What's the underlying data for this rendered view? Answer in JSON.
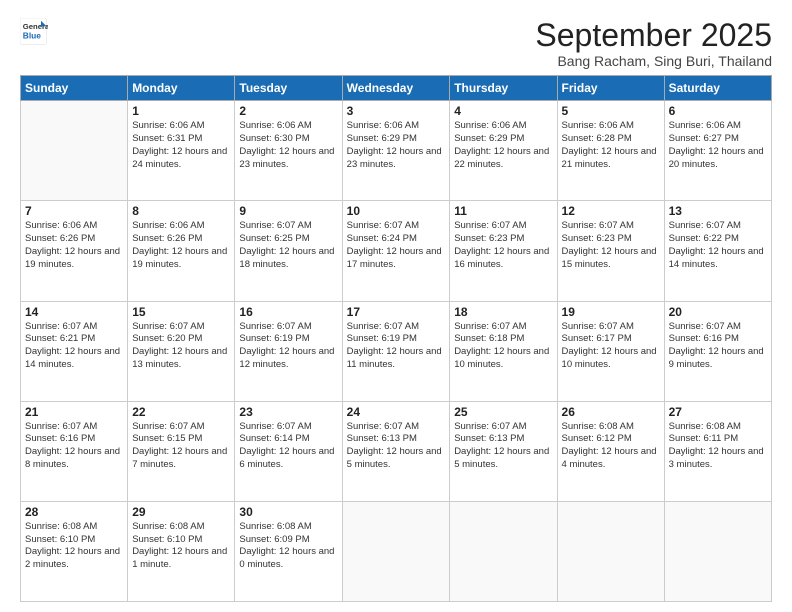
{
  "logo": {
    "line1": "General",
    "line2": "Blue"
  },
  "title": "September 2025",
  "subtitle": "Bang Racham, Sing Buri, Thailand",
  "days_of_week": [
    "Sunday",
    "Monday",
    "Tuesday",
    "Wednesday",
    "Thursday",
    "Friday",
    "Saturday"
  ],
  "weeks": [
    [
      {
        "day": null
      },
      {
        "day": 1,
        "sunrise": "6:06 AM",
        "sunset": "6:31 PM",
        "daylight": "12 hours and 24 minutes."
      },
      {
        "day": 2,
        "sunrise": "6:06 AM",
        "sunset": "6:30 PM",
        "daylight": "12 hours and 23 minutes."
      },
      {
        "day": 3,
        "sunrise": "6:06 AM",
        "sunset": "6:29 PM",
        "daylight": "12 hours and 23 minutes."
      },
      {
        "day": 4,
        "sunrise": "6:06 AM",
        "sunset": "6:29 PM",
        "daylight": "12 hours and 22 minutes."
      },
      {
        "day": 5,
        "sunrise": "6:06 AM",
        "sunset": "6:28 PM",
        "daylight": "12 hours and 21 minutes."
      },
      {
        "day": 6,
        "sunrise": "6:06 AM",
        "sunset": "6:27 PM",
        "daylight": "12 hours and 20 minutes."
      }
    ],
    [
      {
        "day": 7,
        "sunrise": "6:06 AM",
        "sunset": "6:26 PM",
        "daylight": "12 hours and 19 minutes."
      },
      {
        "day": 8,
        "sunrise": "6:06 AM",
        "sunset": "6:26 PM",
        "daylight": "12 hours and 19 minutes."
      },
      {
        "day": 9,
        "sunrise": "6:07 AM",
        "sunset": "6:25 PM",
        "daylight": "12 hours and 18 minutes."
      },
      {
        "day": 10,
        "sunrise": "6:07 AM",
        "sunset": "6:24 PM",
        "daylight": "12 hours and 17 minutes."
      },
      {
        "day": 11,
        "sunrise": "6:07 AM",
        "sunset": "6:23 PM",
        "daylight": "12 hours and 16 minutes."
      },
      {
        "day": 12,
        "sunrise": "6:07 AM",
        "sunset": "6:23 PM",
        "daylight": "12 hours and 15 minutes."
      },
      {
        "day": 13,
        "sunrise": "6:07 AM",
        "sunset": "6:22 PM",
        "daylight": "12 hours and 14 minutes."
      }
    ],
    [
      {
        "day": 14,
        "sunrise": "6:07 AM",
        "sunset": "6:21 PM",
        "daylight": "12 hours and 14 minutes."
      },
      {
        "day": 15,
        "sunrise": "6:07 AM",
        "sunset": "6:20 PM",
        "daylight": "12 hours and 13 minutes."
      },
      {
        "day": 16,
        "sunrise": "6:07 AM",
        "sunset": "6:19 PM",
        "daylight": "12 hours and 12 minutes."
      },
      {
        "day": 17,
        "sunrise": "6:07 AM",
        "sunset": "6:19 PM",
        "daylight": "12 hours and 11 minutes."
      },
      {
        "day": 18,
        "sunrise": "6:07 AM",
        "sunset": "6:18 PM",
        "daylight": "12 hours and 10 minutes."
      },
      {
        "day": 19,
        "sunrise": "6:07 AM",
        "sunset": "6:17 PM",
        "daylight": "12 hours and 10 minutes."
      },
      {
        "day": 20,
        "sunrise": "6:07 AM",
        "sunset": "6:16 PM",
        "daylight": "12 hours and 9 minutes."
      }
    ],
    [
      {
        "day": 21,
        "sunrise": "6:07 AM",
        "sunset": "6:16 PM",
        "daylight": "12 hours and 8 minutes."
      },
      {
        "day": 22,
        "sunrise": "6:07 AM",
        "sunset": "6:15 PM",
        "daylight": "12 hours and 7 minutes."
      },
      {
        "day": 23,
        "sunrise": "6:07 AM",
        "sunset": "6:14 PM",
        "daylight": "12 hours and 6 minutes."
      },
      {
        "day": 24,
        "sunrise": "6:07 AM",
        "sunset": "6:13 PM",
        "daylight": "12 hours and 5 minutes."
      },
      {
        "day": 25,
        "sunrise": "6:07 AM",
        "sunset": "6:13 PM",
        "daylight": "12 hours and 5 minutes."
      },
      {
        "day": 26,
        "sunrise": "6:08 AM",
        "sunset": "6:12 PM",
        "daylight": "12 hours and 4 minutes."
      },
      {
        "day": 27,
        "sunrise": "6:08 AM",
        "sunset": "6:11 PM",
        "daylight": "12 hours and 3 minutes."
      }
    ],
    [
      {
        "day": 28,
        "sunrise": "6:08 AM",
        "sunset": "6:10 PM",
        "daylight": "12 hours and 2 minutes."
      },
      {
        "day": 29,
        "sunrise": "6:08 AM",
        "sunset": "6:10 PM",
        "daylight": "12 hours and 1 minute."
      },
      {
        "day": 30,
        "sunrise": "6:08 AM",
        "sunset": "6:09 PM",
        "daylight": "12 hours and 0 minutes."
      },
      {
        "day": null
      },
      {
        "day": null
      },
      {
        "day": null
      },
      {
        "day": null
      }
    ]
  ]
}
